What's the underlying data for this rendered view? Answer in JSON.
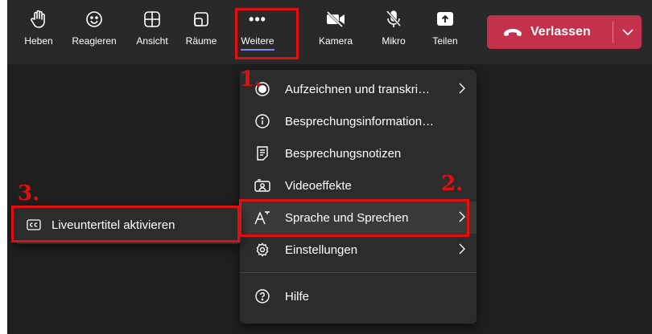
{
  "toolbar": {
    "buttons": [
      {
        "label": "Heben",
        "icon": "raise-hand-icon"
      },
      {
        "label": "Reagieren",
        "icon": "emoji-icon"
      },
      {
        "label": "Ansicht",
        "icon": "grid-view-icon"
      },
      {
        "label": "Räume",
        "icon": "breakout-rooms-icon"
      },
      {
        "label": "Weitere",
        "icon": "more-dots-icon",
        "glyph": "•••"
      },
      {
        "label": "Kamera",
        "icon": "camera-off-icon"
      },
      {
        "label": "Mikro",
        "icon": "mic-off-icon"
      },
      {
        "label": "Teilen",
        "icon": "share-icon"
      }
    ],
    "leave": {
      "label": "Verlassen",
      "icon": "hang-up-icon",
      "color": "#c4314b"
    }
  },
  "more_menu": {
    "items": [
      {
        "label": "Aufzeichnen und transkri…",
        "icon": "record-icon"
      },
      {
        "label": "Besprechungsinformation…",
        "icon": "info-icon"
      },
      {
        "label": "Besprechungsnotizen",
        "icon": "notes-icon"
      },
      {
        "label": "Videoeffekte",
        "icon": "video-effects-icon"
      },
      {
        "label": "Sprache und Sprechen",
        "icon": "language-icon"
      },
      {
        "label": "Einstellungen",
        "icon": "settings-gear-icon"
      },
      {
        "label": "Hilfe",
        "icon": "help-icon"
      }
    ]
  },
  "submenu": {
    "items": [
      {
        "label": "Liveuntertitel aktivieren",
        "icon": "closed-captions-icon"
      }
    ]
  },
  "annotations": {
    "step1": "1.",
    "step2": "2.",
    "step3": "3.",
    "color": "#e01010"
  }
}
